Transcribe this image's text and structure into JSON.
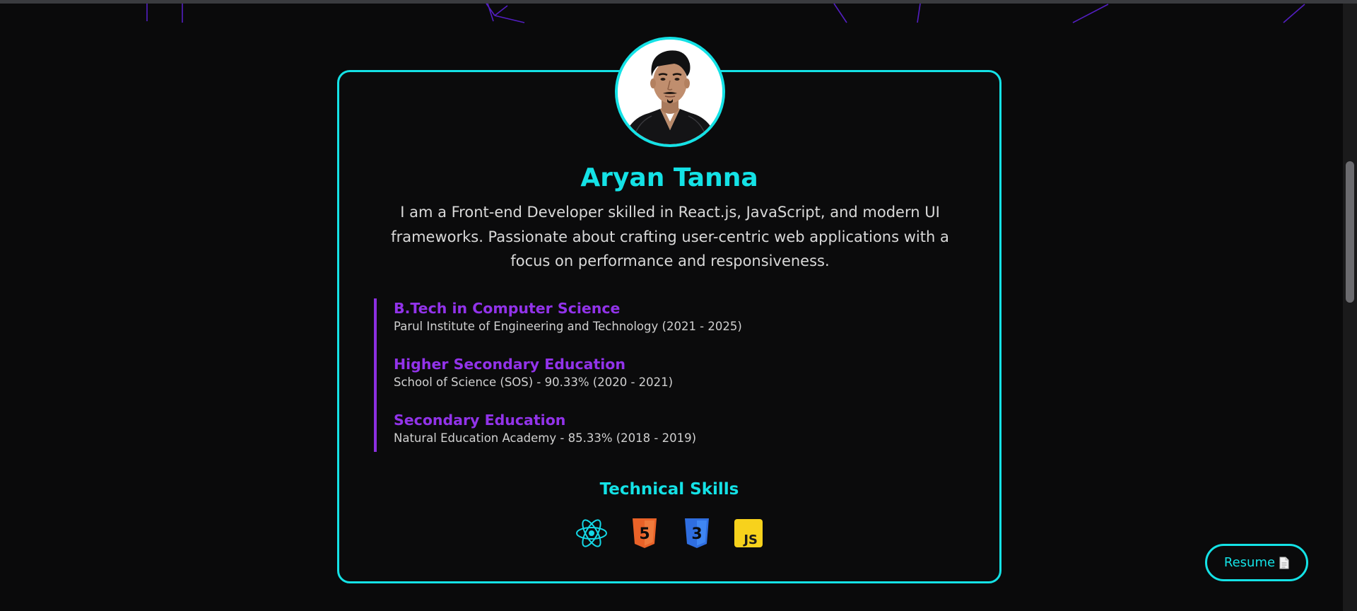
{
  "profile": {
    "name": "Aryan Tanna",
    "bio": "I am a Front-end Developer skilled in React.js, JavaScript, and modern UI frameworks. Passionate about crafting user-centric web applications with a focus on performance and responsiveness."
  },
  "education": [
    {
      "title": "B.Tech in Computer Science",
      "detail": "Parul Institute of Engineering and Technology (2021 - 2025)"
    },
    {
      "title": "Higher Secondary Education",
      "detail": "School of Science (SOS) - 90.33% (2020 - 2021)"
    },
    {
      "title": "Secondary Education",
      "detail": "Natural Education Academy - 85.33% (2018 - 2019)"
    }
  ],
  "skills": {
    "title": "Technical Skills",
    "icons": [
      "react-icon",
      "html5-icon",
      "css3-icon",
      "javascript-icon"
    ],
    "html5_badge": "5",
    "css3_badge": "3",
    "js_badge": "JS"
  },
  "resume_button": {
    "label": "Resume",
    "icon": "document-icon"
  },
  "colors": {
    "accent": "#14e2e6",
    "purple": "#9233ea",
    "background": "#0a0a0b"
  }
}
